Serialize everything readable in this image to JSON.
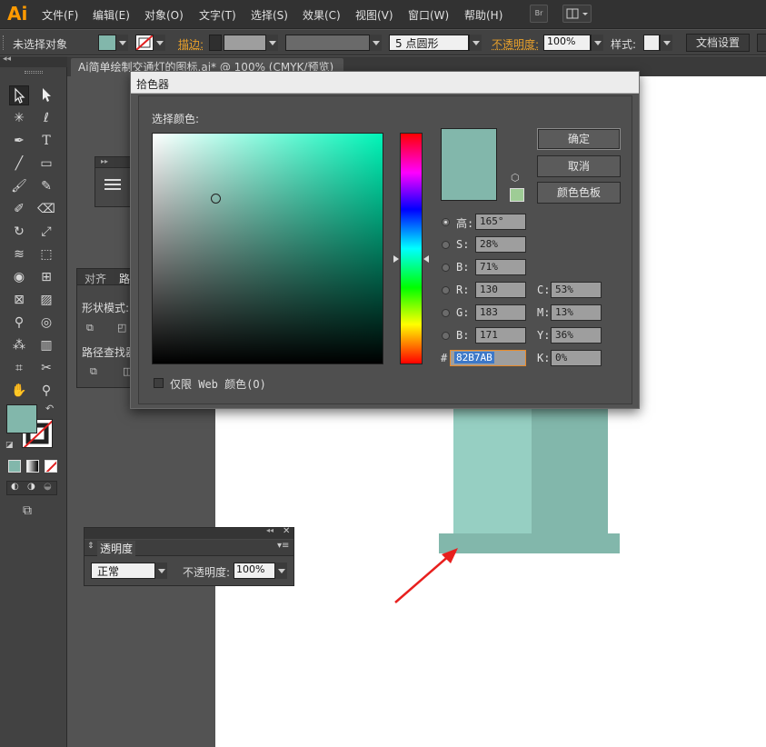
{
  "app": {
    "logo": "Ai",
    "menus": [
      "文件(F)",
      "编辑(E)",
      "对象(O)",
      "文字(T)",
      "选择(S)",
      "效果(C)",
      "视图(V)",
      "窗口(W)",
      "帮助(H)"
    ],
    "bridge_btn": "Br"
  },
  "control_bar": {
    "selection_status": "未选择对象",
    "stroke_label": "描边:",
    "brush_value": "5 点圆形",
    "opacity_label": "不透明度:",
    "opacity_value": "100%",
    "style_label": "样式:",
    "doc_settings": "文档设置"
  },
  "document_tab": {
    "title": "Ai简单绘制交通灯的图标.ai* @ 100% (CMYK/预览)"
  },
  "side_panels": {
    "align_tab": "对齐",
    "pathfinder_tab": "路",
    "shape_modes": "形状模式:",
    "pathfinder": "路径查找器"
  },
  "transparency_panel": {
    "title": "透明度",
    "blend_mode": "正常",
    "opacity_label": "不透明度:",
    "opacity_value": "100%"
  },
  "color_picker": {
    "title": "拾色器",
    "select_color_label": "选择颜色:",
    "ok": "确定",
    "cancel": "取消",
    "swatches": "颜色色板",
    "hsb": [
      {
        "label": "高:",
        "value": "165°",
        "selected": true
      },
      {
        "label": "S:",
        "value": "28%",
        "selected": false
      },
      {
        "label": "B:",
        "value": "71%",
        "selected": false
      }
    ],
    "rgb": [
      {
        "label": "R:",
        "value": "130"
      },
      {
        "label": "G:",
        "value": "183"
      },
      {
        "label": "B:",
        "value": "171"
      }
    ],
    "cmyk": [
      {
        "label": "C:",
        "value": "53%"
      },
      {
        "label": "M:",
        "value": "13%"
      },
      {
        "label": "Y:",
        "value": "36%"
      },
      {
        "label": "K:",
        "value": "0%"
      }
    ],
    "hex_prefix": "#",
    "hex_value": "82B7AB",
    "web_only": "仅限 Web 颜色(O)"
  },
  "colors": {
    "selected_color": "#82b7ab",
    "pillar_light": "#96cfc2",
    "pillar_dark": "#82b7ab",
    "accent_orange": "#e8a02b",
    "arrow_red": "#e8201e"
  }
}
